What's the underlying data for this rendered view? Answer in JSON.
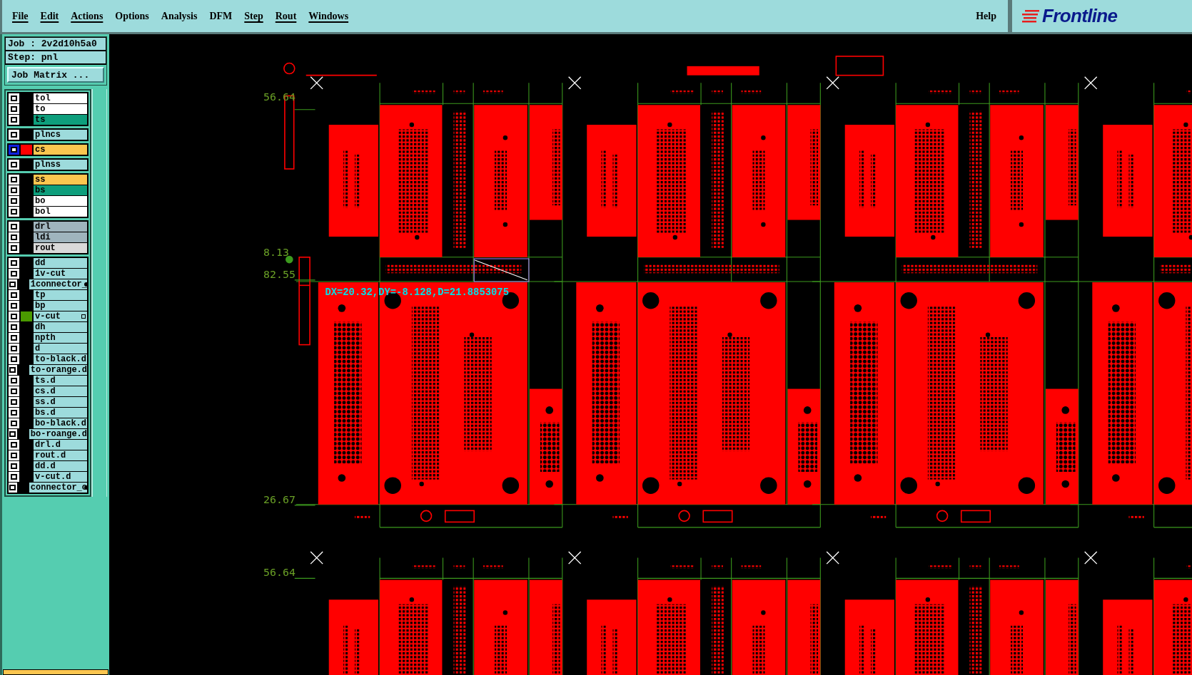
{
  "menu_bar": {
    "items": [
      {
        "label": "File",
        "underline": true
      },
      {
        "label": "Edit",
        "underline": true
      },
      {
        "label": "Actions",
        "underline": true
      },
      {
        "label": "Options",
        "underline": false
      },
      {
        "label": "Analysis",
        "underline": false
      },
      {
        "label": "DFM",
        "underline": false
      },
      {
        "label": "Step",
        "underline": true
      },
      {
        "label": "Rout",
        "underline": true
      },
      {
        "label": "Windows",
        "underline": true
      }
    ],
    "help": "Help"
  },
  "logo": {
    "text": "Frontline"
  },
  "job_panel": {
    "job": "Job : 2v2d10h5a0",
    "step": "Step: pnl",
    "job_matrix_button": "Job Matrix ..."
  },
  "layer_groups": [
    {
      "layers": [
        {
          "name": "tol",
          "kind": "silk_screen",
          "selected": false,
          "clipped": false,
          "feature_mark": false
        },
        {
          "name": "to",
          "kind": "silk_screen",
          "selected": false,
          "clipped": false,
          "feature_mark": false
        },
        {
          "name": "ts",
          "kind": "solder_mask",
          "selected": false,
          "clipped": false,
          "feature_mark": false
        }
      ]
    },
    {
      "layers": [
        {
          "name": "plncs",
          "kind": "misc",
          "selected": false,
          "clipped": false,
          "feature_mark": false
        }
      ]
    },
    {
      "layers": [
        {
          "name": "cs",
          "kind": "signal",
          "selected": true,
          "clipped": false,
          "feature_mark": false,
          "color": "#ff0000"
        }
      ]
    },
    {
      "layers": [
        {
          "name": "plnss",
          "kind": "misc",
          "selected": false,
          "clipped": false,
          "feature_mark": false
        }
      ]
    },
    {
      "layers": [
        {
          "name": "ss",
          "kind": "signal",
          "selected": false,
          "clipped": false,
          "feature_mark": false
        },
        {
          "name": "bs",
          "kind": "solder_mask",
          "selected": false,
          "clipped": false,
          "feature_mark": false
        },
        {
          "name": "bo",
          "kind": "silk_screen",
          "selected": false,
          "clipped": false,
          "feature_mark": false
        },
        {
          "name": "bol",
          "kind": "silk_screen",
          "selected": false,
          "clipped": false,
          "feature_mark": false
        }
      ]
    },
    {
      "layers": [
        {
          "name": "drl",
          "kind": "drill",
          "selected": false,
          "clipped": false,
          "feature_mark": false
        },
        {
          "name": "ldi",
          "kind": "drill",
          "selected": false,
          "clipped": false,
          "feature_mark": false
        },
        {
          "name": "rout",
          "kind": "rout",
          "selected": false,
          "clipped": false,
          "feature_mark": false
        }
      ]
    },
    {
      "layers": [
        {
          "name": "dd",
          "kind": "misc",
          "selected": false,
          "clipped": false,
          "feature_mark": false
        },
        {
          "name": "1v-cut",
          "kind": "misc",
          "selected": false,
          "clipped": false,
          "feature_mark": false
        },
        {
          "name": "1connector_",
          "kind": "misc",
          "selected": false,
          "clipped": true,
          "feature_mark": false
        },
        {
          "name": "tp",
          "kind": "misc",
          "selected": false,
          "clipped": false,
          "feature_mark": false
        },
        {
          "name": "bp",
          "kind": "misc",
          "selected": false,
          "clipped": false,
          "feature_mark": false
        },
        {
          "name": "v-cut",
          "kind": "misc",
          "selected": false,
          "clipped": false,
          "feature_mark": true,
          "color": "#4a9a00"
        },
        {
          "name": "dh",
          "kind": "misc",
          "selected": false,
          "clipped": false,
          "feature_mark": false
        },
        {
          "name": "npth",
          "kind": "misc",
          "selected": false,
          "clipped": false,
          "feature_mark": false
        },
        {
          "name": "d",
          "kind": "misc",
          "selected": false,
          "clipped": false,
          "feature_mark": false
        },
        {
          "name": "to-black.d",
          "kind": "misc",
          "selected": false,
          "clipped": false,
          "feature_mark": false
        },
        {
          "name": "to-orange.d",
          "kind": "misc",
          "selected": false,
          "clipped": false,
          "feature_mark": false
        },
        {
          "name": "ts.d",
          "kind": "misc",
          "selected": false,
          "clipped": false,
          "feature_mark": false
        },
        {
          "name": "cs.d",
          "kind": "misc",
          "selected": false,
          "clipped": false,
          "feature_mark": false
        },
        {
          "name": "ss.d",
          "kind": "misc",
          "selected": false,
          "clipped": false,
          "feature_mark": false
        },
        {
          "name": "bs.d",
          "kind": "misc",
          "selected": false,
          "clipped": false,
          "feature_mark": false
        },
        {
          "name": "bo-black.d",
          "kind": "misc",
          "selected": false,
          "clipped": false,
          "feature_mark": false
        },
        {
          "name": "bo-roange.d",
          "kind": "misc",
          "selected": false,
          "clipped": false,
          "feature_mark": false
        },
        {
          "name": "drl.d",
          "kind": "misc",
          "selected": false,
          "clipped": false,
          "feature_mark": false
        },
        {
          "name": "rout.d",
          "kind": "misc",
          "selected": false,
          "clipped": false,
          "feature_mark": false
        },
        {
          "name": "dd.d",
          "kind": "misc",
          "selected": false,
          "clipped": false,
          "feature_mark": false
        },
        {
          "name": "v-cut.d",
          "kind": "misc",
          "selected": false,
          "clipped": false,
          "feature_mark": false
        },
        {
          "name": "connector_o",
          "kind": "misc",
          "selected": false,
          "clipped": true,
          "feature_mark": false
        }
      ]
    }
  ],
  "canvas": {
    "coordinate_labels": [
      "56.64",
      "8.13",
      "82.55",
      "26.67",
      "56.64"
    ],
    "measurement": "DX=20.32,DY=-8.128,D=21.8853075"
  }
}
